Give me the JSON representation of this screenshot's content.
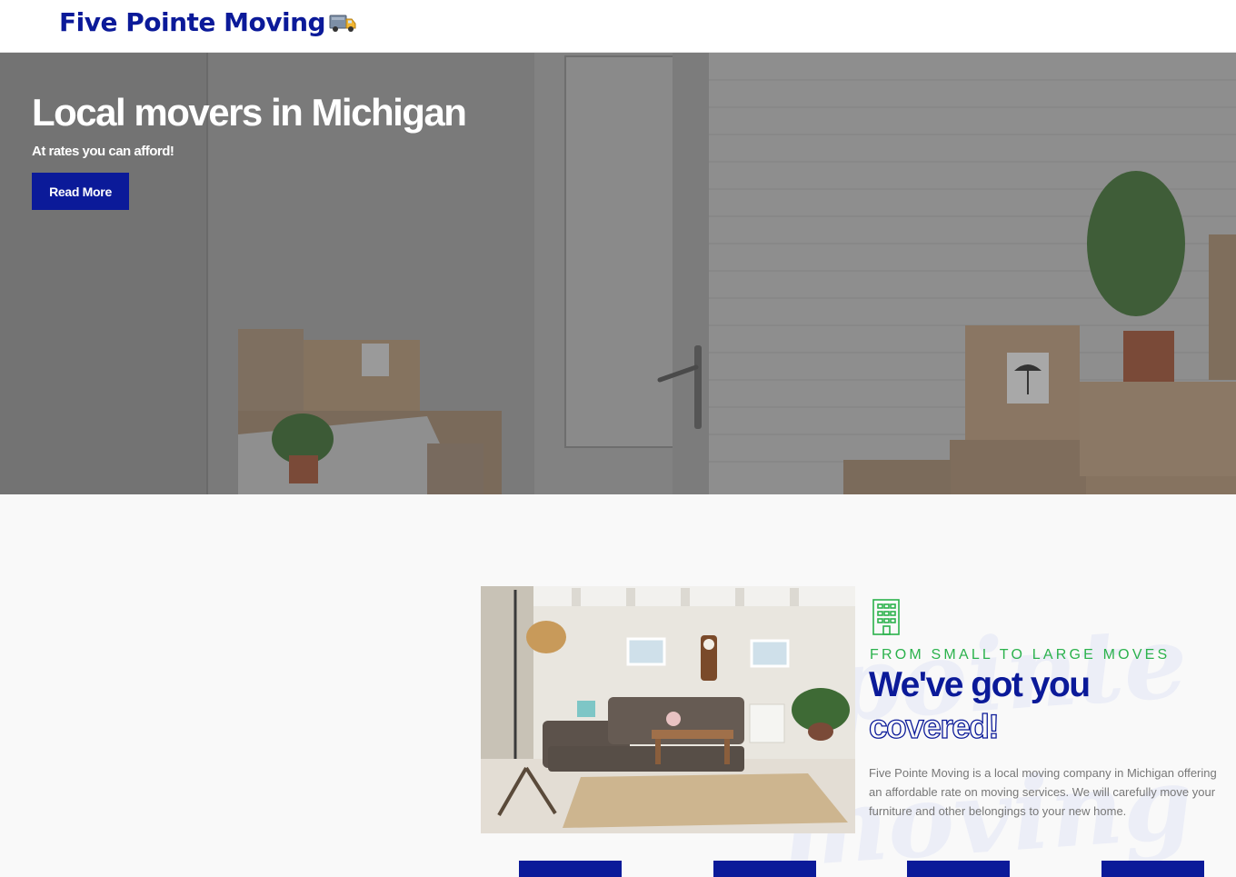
{
  "header": {
    "logo_text": "Five Pointe Moving",
    "logo_icon": "truck-icon"
  },
  "hero": {
    "title": "Local movers in Michigan",
    "subtitle": "At rates you can afford!",
    "button_label": "Read More"
  },
  "about": {
    "icon": "building-icon",
    "eyebrow": "FROM SMALL TO LARGE MOVES",
    "heading_line1": "We've got you",
    "heading_line2": "covered!",
    "body": "Five Pointe Moving is a local moving company in Michigan offering an affordable rate on moving services. We will carefully move your furniture and other belongings to your new home.",
    "watermark_line1": "fivepointe",
    "watermark_line2": "moving"
  },
  "service_buttons": [
    "",
    "",
    "",
    ""
  ],
  "colors": {
    "brand_blue": "#0b1a99",
    "accent_green": "#2bb24c",
    "muted_text": "#777777"
  }
}
